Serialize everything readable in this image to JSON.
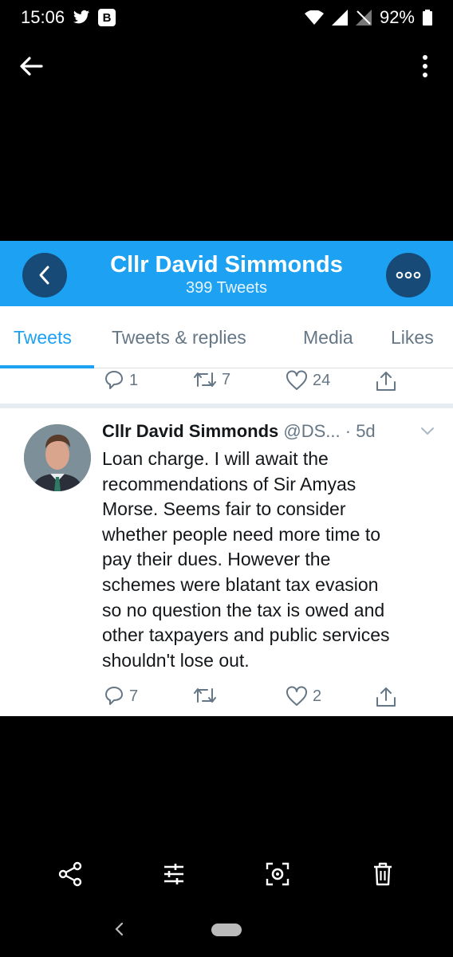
{
  "status_bar": {
    "time": "15:06",
    "badge": "B",
    "battery": "92%"
  },
  "viewer": {
    "back_icon": "arrow-left-icon",
    "menu_icon": "more-vert-icon"
  },
  "profile": {
    "name": "Cllr David Simmonds",
    "tweet_count": "399 Tweets"
  },
  "tabs": [
    {
      "label": "Tweets",
      "active": true
    },
    {
      "label": "Tweets & replies",
      "active": false
    },
    {
      "label": "Media",
      "active": false
    },
    {
      "label": "Likes",
      "active": false
    }
  ],
  "prev_tweet_actions": {
    "replies": "1",
    "retweets": "7",
    "likes": "24"
  },
  "tweet": {
    "author": "Cllr David Simmonds",
    "handle_time": "@DS... · 5d",
    "lines": [
      "Loan charge. I will await the",
      "recommendations of Sir Amyas",
      "Morse. Seems fair to consider",
      "whether people need more time to",
      "pay their dues. However the",
      "schemes were blatant tax evasion",
      "so no question the tax is owed and",
      "other taxpayers and public services",
      "shouldn't lose out."
    ],
    "replies": "7",
    "retweets": "",
    "likes": "2"
  },
  "colors": {
    "twitter_blue": "#1da1f2",
    "header_button": "#174a77",
    "muted": "#657786"
  }
}
